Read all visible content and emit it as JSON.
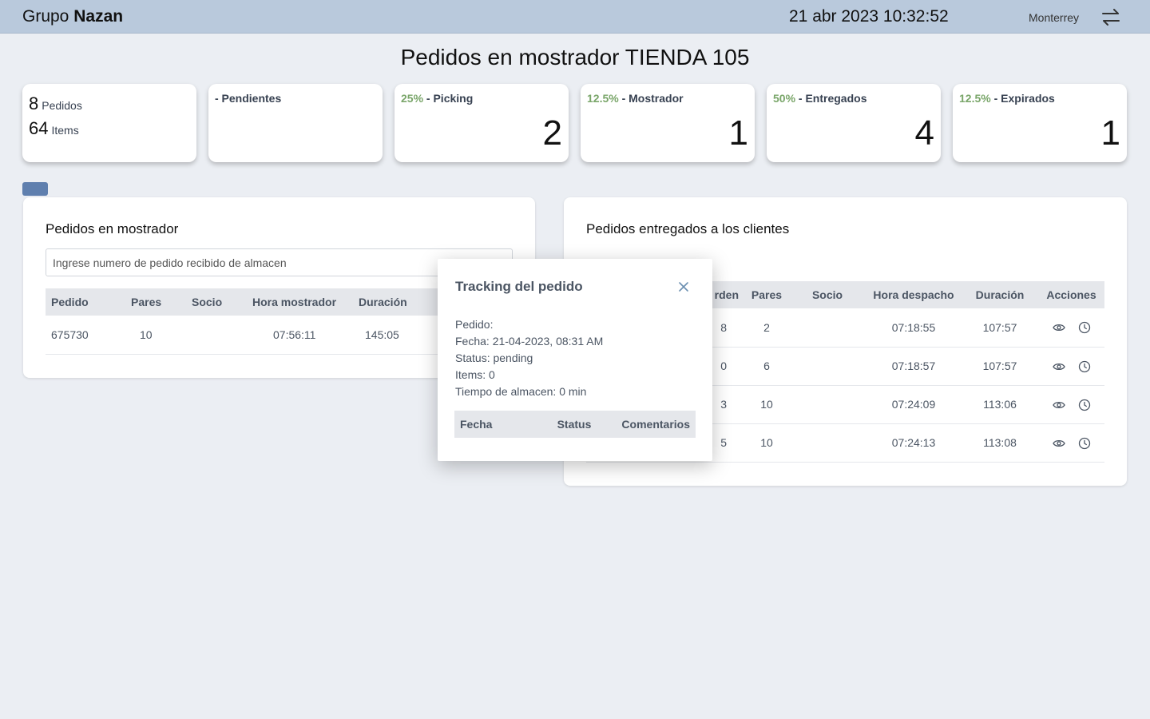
{
  "header": {
    "brand_prefix": "Grupo",
    "brand_name": "Nazan",
    "datetime": "21 abr 2023 10:32:52",
    "city": "Monterrey",
    "switch_icon": "swap-arrows-icon"
  },
  "title": "Pedidos en mostrador TIENDA 105",
  "summary": {
    "pedidos_count": "8",
    "pedidos_label": "Pedidos",
    "items_count": "64",
    "items_label": "Items"
  },
  "cards": [
    {
      "pct": "",
      "label": "- Pendientes",
      "value": ""
    },
    {
      "pct": "25%",
      "label": " - Picking",
      "value": "2"
    },
    {
      "pct": "12.5%",
      "label": " - Mostrador",
      "value": "1"
    },
    {
      "pct": "50%",
      "label": " - Entregados",
      "value": "4"
    },
    {
      "pct": "12.5%",
      "label": " - Expirados",
      "value": "1"
    }
  ],
  "left_panel": {
    "title": "Pedidos en mostrador",
    "search_placeholder": "Ingrese numero de pedido recibido de almacen",
    "columns": [
      "Pedido",
      "Pares",
      "Socio",
      "Hora mostrador",
      "Duración"
    ],
    "rows": [
      {
        "pedido": "675730",
        "pares": "10",
        "socio": "",
        "hora": "07:56:11",
        "duracion": "145:05"
      }
    ]
  },
  "right_panel": {
    "title": "Pedidos entregados a los clientes",
    "columns": [
      "rden",
      "Pares",
      "Socio",
      "Hora despacho",
      "Duración",
      "Acciones"
    ],
    "rows": [
      {
        "orden": "8",
        "pares": "2",
        "socio": "",
        "hora": "07:18:55",
        "duracion": "107:57"
      },
      {
        "orden": "0",
        "pares": "6",
        "socio": "",
        "hora": "07:18:57",
        "duracion": "107:57"
      },
      {
        "orden": "3",
        "pares": "10",
        "socio": "",
        "hora": "07:24:09",
        "duracion": "113:06"
      },
      {
        "orden": "5",
        "pares": "10",
        "socio": "",
        "hora": "07:24:13",
        "duracion": "113:08"
      }
    ],
    "action_icons": [
      "eye-icon",
      "clock-icon"
    ]
  },
  "modal": {
    "title": "Tracking del pedido",
    "pedido": "Pedido:",
    "fecha": "Fecha: 21-04-2023, 08:31 AM",
    "status": "Status: pending",
    "items": "Items: 0",
    "tiempo": "Tiempo de almacen: 0 min",
    "columns": [
      "Fecha",
      "Status",
      "Comentarios"
    ]
  },
  "colors": {
    "topbar": "#b9c9dc",
    "background": "#ebeef3",
    "percent_green": "#7aa66a",
    "tab_blue": "#5f7fae"
  }
}
